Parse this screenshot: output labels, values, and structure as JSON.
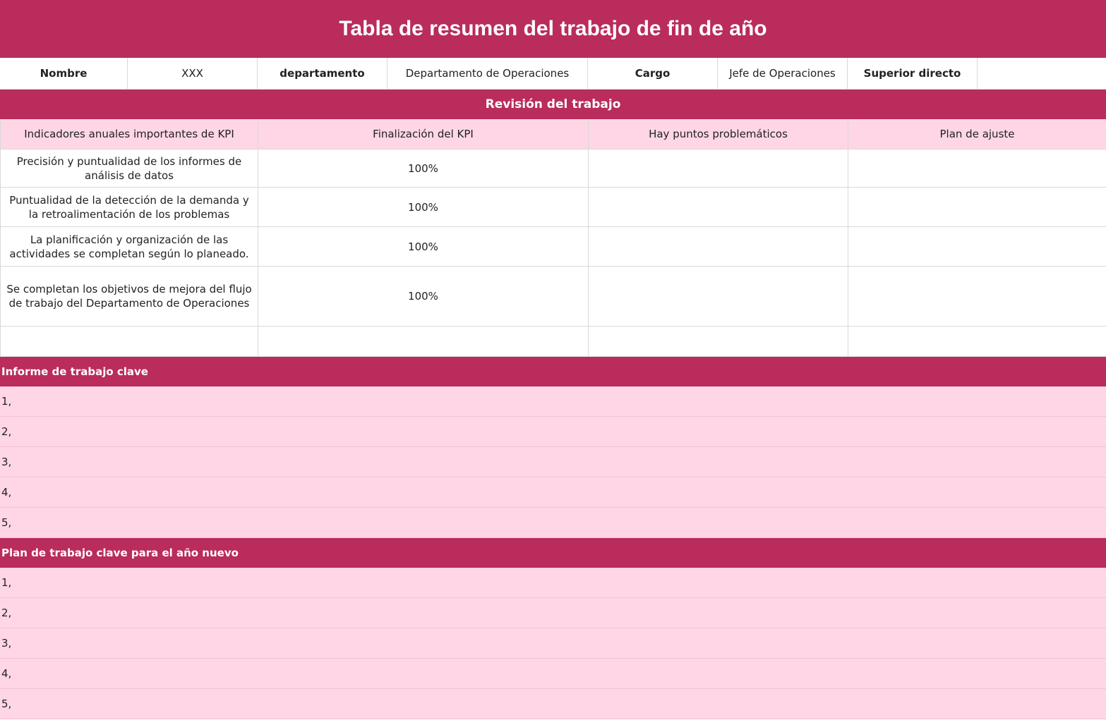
{
  "title": "Tabla de resumen del trabajo de fin de año",
  "info": {
    "name_label": "Nombre",
    "name_value": "XXX",
    "department_label": "departamento",
    "department_value": "Departamento de Operaciones",
    "position_label": "Cargo",
    "position_value": "Jefe de Operaciones",
    "supervisor_label": "Superior directo",
    "supervisor_value": ""
  },
  "review": {
    "heading": "Revisión del trabajo",
    "columns": [
      "Indicadores anuales importantes de KPI",
      "Finalización del KPI",
      "Hay puntos problemáticos",
      "Plan de ajuste"
    ],
    "rows": [
      {
        "indicator": "Precisión y puntualidad de los informes de análisis de datos",
        "completion": "100%",
        "problems": "",
        "plan": ""
      },
      {
        "indicator": "Puntualidad de la detección de la demanda y la retroalimentación de los problemas",
        "completion": "100%",
        "problems": "",
        "plan": ""
      },
      {
        "indicator": "La planificación y organización de las actividades se completan según lo planeado.",
        "completion": "100%",
        "problems": "",
        "plan": ""
      },
      {
        "indicator": "Se completan los objetivos de mejora del flujo de trabajo del Departamento de Operaciones",
        "completion": "100%",
        "problems": "",
        "plan": ""
      },
      {
        "indicator": "",
        "completion": "",
        "problems": "",
        "plan": ""
      }
    ]
  },
  "key_report": {
    "heading": "Informe de trabajo clave",
    "items": [
      "1,",
      "2,",
      "3,",
      "4,",
      "5,"
    ]
  },
  "new_year_plan": {
    "heading": "Plan de trabajo clave para el año nuevo",
    "items": [
      "1,",
      "2,",
      "3,",
      "4,",
      "5,"
    ]
  },
  "colors": {
    "accent": "#b92c5b",
    "light_pink": "#ffd6e6"
  }
}
